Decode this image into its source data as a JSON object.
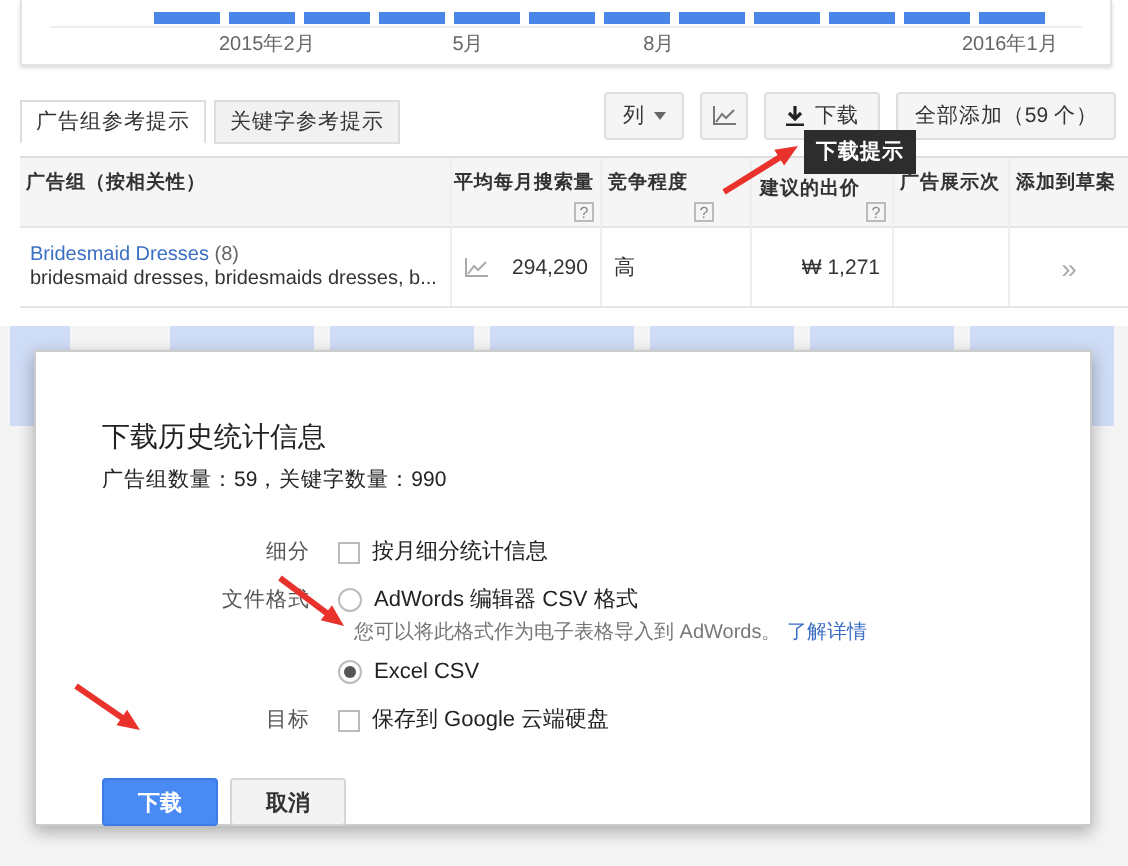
{
  "chart": {
    "x_labels": [
      "2015年2月",
      "5月",
      "8月",
      "2016年1月"
    ]
  },
  "tabs": [
    {
      "label": "广告组参考提示",
      "selected": true
    },
    {
      "label": "关键字参考提示",
      "selected": false
    }
  ],
  "toolbar": {
    "columns_button": "列",
    "download_button": "下载",
    "add_all_button": "全部添加（59 个）"
  },
  "tooltip": "下载提示",
  "table": {
    "columns": [
      {
        "label": "广告组（按相关性）"
      },
      {
        "label": "平均每月搜索量",
        "help": "?"
      },
      {
        "label": "竞争程度",
        "help": "?"
      },
      {
        "label": "建议的出价",
        "help": "?"
      },
      {
        "label": "广告展示次"
      },
      {
        "label": "添加到草案"
      }
    ],
    "rows": [
      {
        "group": "Bridesmaid Dresses",
        "count": "(8)",
        "keywords": "bridesmaid dresses, bridesmaids dresses, b...",
        "searches": "294,290",
        "competition": "高",
        "bid": "₩ 1,271",
        "add": "»"
      }
    ]
  },
  "dialog": {
    "title": "下载历史统计信息",
    "summary": "广告组数量：59，关键字数量：990",
    "options": [
      {
        "label": "细分",
        "kind": "checkbox",
        "text": "按月细分统计信息",
        "checked": false
      },
      {
        "label": "文件格式",
        "kind": "radio-group",
        "choices": [
          {
            "text": "AdWords 编辑器 CSV 格式",
            "hint": "您可以将此格式作为电子表格导入到 AdWords。",
            "link": "了解详情",
            "selected": false
          },
          {
            "text": "Excel CSV",
            "selected": true
          }
        ]
      },
      {
        "label": "目标",
        "kind": "checkbox",
        "text": "保存到 Google 云端硬盘",
        "checked": false
      }
    ],
    "buttons": [
      {
        "label": "下载",
        "primary": true
      },
      {
        "label": "取消",
        "primary": false
      }
    ]
  }
}
